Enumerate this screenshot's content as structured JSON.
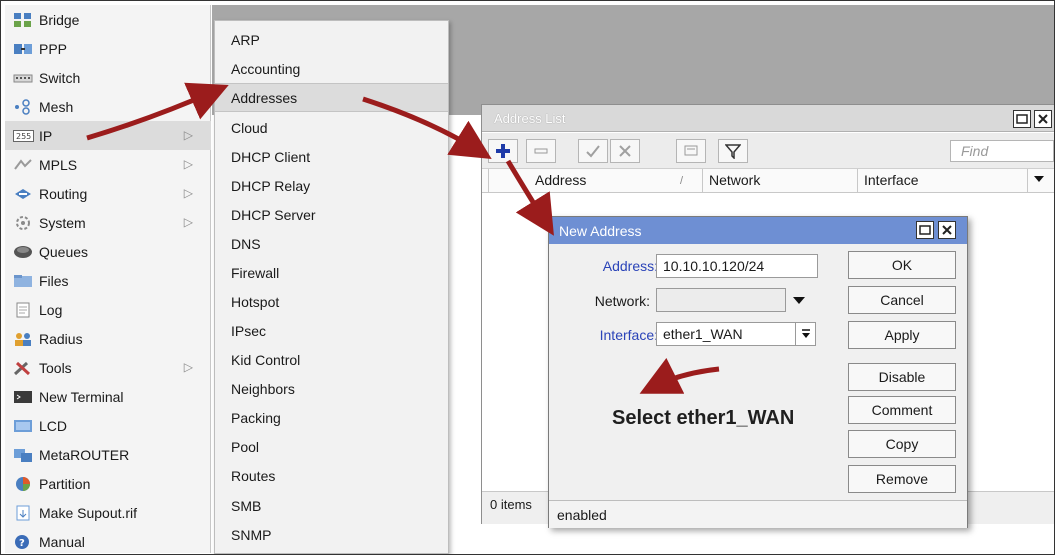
{
  "main_menu": {
    "items": [
      {
        "label": "Bridge",
        "icon": "bridge-icon",
        "submenu": false
      },
      {
        "label": "PPP",
        "icon": "ppp-icon",
        "submenu": false
      },
      {
        "label": "Switch",
        "icon": "switch-icon",
        "submenu": false
      },
      {
        "label": "Mesh",
        "icon": "mesh-icon",
        "submenu": false
      },
      {
        "label": "IP",
        "icon": "ip-icon",
        "submenu": true
      },
      {
        "label": "MPLS",
        "icon": "mpls-icon",
        "submenu": true
      },
      {
        "label": "Routing",
        "icon": "routing-icon",
        "submenu": true
      },
      {
        "label": "System",
        "icon": "system-icon",
        "submenu": true
      },
      {
        "label": "Queues",
        "icon": "queues-icon",
        "submenu": false
      },
      {
        "label": "Files",
        "icon": "files-icon",
        "submenu": false
      },
      {
        "label": "Log",
        "icon": "log-icon",
        "submenu": false
      },
      {
        "label": "Radius",
        "icon": "radius-icon",
        "submenu": false
      },
      {
        "label": "Tools",
        "icon": "tools-icon",
        "submenu": true
      },
      {
        "label": "New Terminal",
        "icon": "terminal-icon",
        "submenu": false
      },
      {
        "label": "LCD",
        "icon": "lcd-icon",
        "submenu": false
      },
      {
        "label": "MetaROUTER",
        "icon": "metarouter-icon",
        "submenu": false
      },
      {
        "label": "Partition",
        "icon": "partition-icon",
        "submenu": false
      },
      {
        "label": "Make Supout.rif",
        "icon": "supout-icon",
        "submenu": false
      },
      {
        "label": "Manual",
        "icon": "manual-icon",
        "submenu": false
      }
    ],
    "submenu_arrow": "▷"
  },
  "ip_submenu": {
    "items": [
      "ARP",
      "Accounting",
      "Addresses",
      "Cloud",
      "DHCP Client",
      "DHCP Relay",
      "DHCP Server",
      "DNS",
      "Firewall",
      "Hotspot",
      "IPsec",
      "Kid Control",
      "Neighbors",
      "Packing",
      "Pool",
      "Routes",
      "SMB",
      "SNMP"
    ],
    "highlighted": "Addresses"
  },
  "address_list": {
    "title": "Address List",
    "find_placeholder": "Find",
    "columns": [
      "Address",
      "Network",
      "Interface"
    ],
    "sort_indicator": "/",
    "items_count": "0 items",
    "toolbar": [
      "add-icon",
      "remove-icon",
      "enable-icon",
      "disable-icon",
      "comment-icon",
      "filter-icon"
    ]
  },
  "new_address": {
    "title": "New Address",
    "address_label": "Address:",
    "address_value": "10.10.10.120/24",
    "network_label": "Network:",
    "network_value": "",
    "interface_label": "Interface:",
    "interface_value": "ether1_WAN",
    "buttons": {
      "ok": "OK",
      "cancel": "Cancel",
      "apply": "Apply",
      "disable": "Disable",
      "comment": "Comment",
      "copy": "Copy",
      "remove": "Remove"
    },
    "status": "enabled"
  },
  "annotation": {
    "text": "Select ether1_WAN",
    "arrow_color": "#9b1c1c"
  },
  "colors": {
    "dialog_title_bar": "#6e8fd3",
    "label_blue": "#2a43b8",
    "desktop_gray": "#a7a7a7"
  }
}
